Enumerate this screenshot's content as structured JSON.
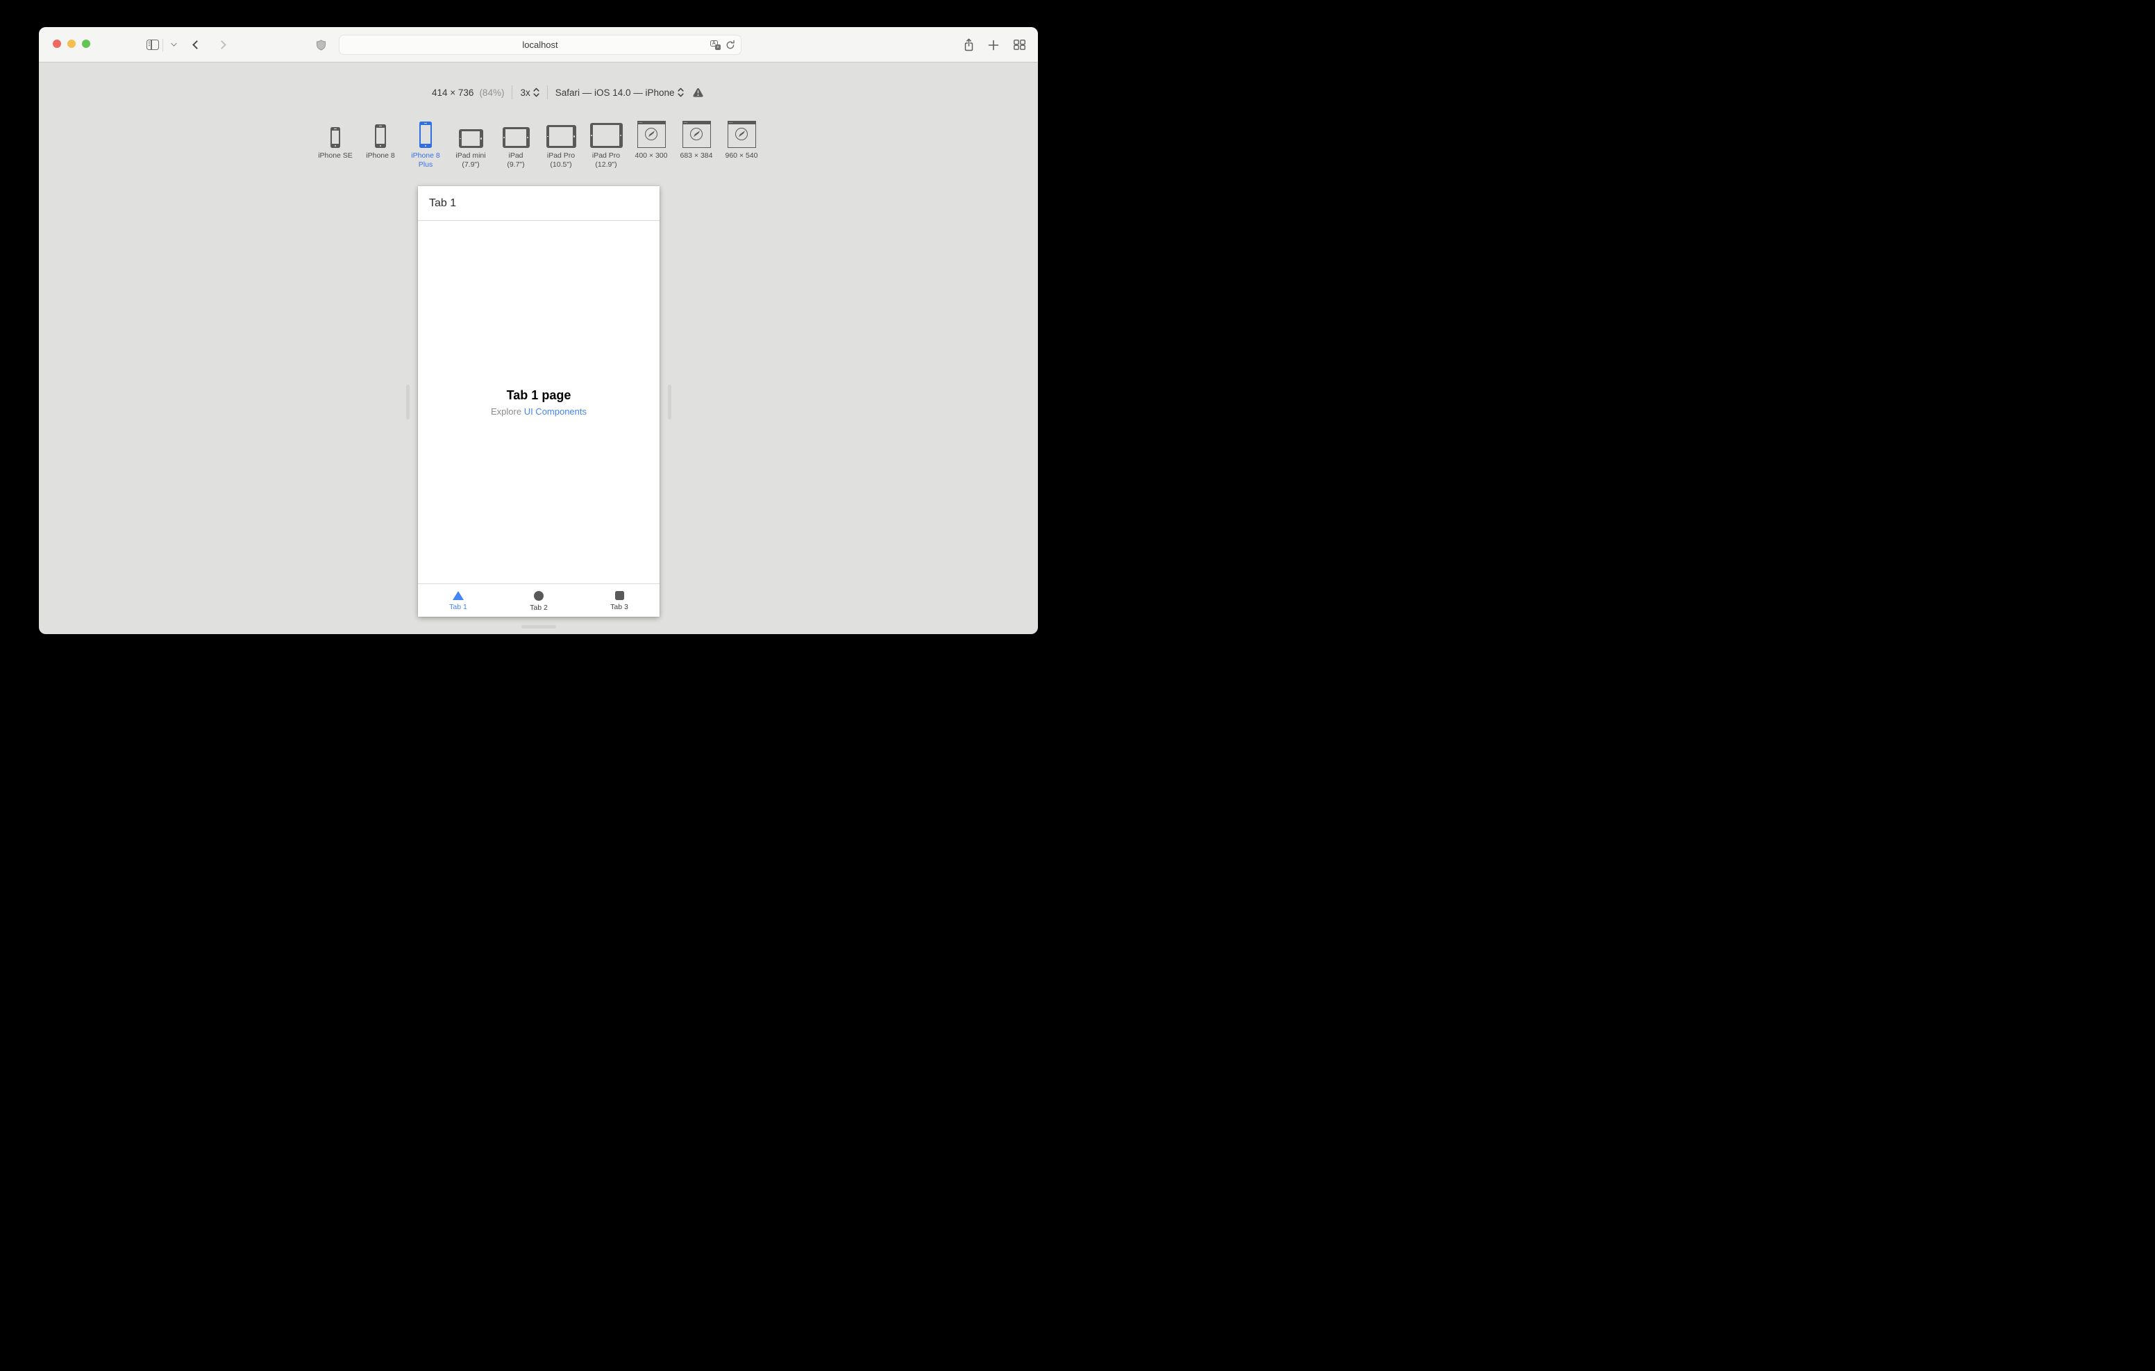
{
  "browser": {
    "address": "localhost"
  },
  "responsive_toolbar": {
    "dimensions": "414 × 736",
    "zoom": "(84%)",
    "scale": "3x",
    "user_agent": "Safari — iOS 14.0 — iPhone"
  },
  "devices": [
    {
      "label": "iPhone SE",
      "label2": "",
      "type": "iphone-icon",
      "selected": false
    },
    {
      "label": "iPhone 8",
      "label2": "",
      "type": "iphone-icon",
      "selected": false
    },
    {
      "label": "iPhone 8",
      "label2": "Plus",
      "type": "iphone-icon",
      "selected": true
    },
    {
      "label": "iPad mini",
      "label2": "(7.9\")",
      "type": "ipad-icon",
      "selected": false
    },
    {
      "label": "iPad",
      "label2": "(9.7\")",
      "type": "ipad-icon",
      "selected": false
    },
    {
      "label": "iPad Pro",
      "label2": "(10.5\")",
      "type": "ipad-icon",
      "selected": false
    },
    {
      "label": "iPad Pro",
      "label2": "(12.9\")",
      "type": "ipad-icon",
      "selected": false
    },
    {
      "label": "400 × 300",
      "label2": "",
      "type": "safari-window-icon",
      "selected": false
    },
    {
      "label": "683 × 384",
      "label2": "",
      "type": "safari-window-icon",
      "selected": false
    },
    {
      "label": "960 × 540",
      "label2": "",
      "type": "safari-window-icon",
      "selected": false
    }
  ],
  "preview": {
    "header_title": "Tab 1",
    "page_title": "Tab 1 page",
    "explore_prefix": "Explore",
    "explore_link": "UI Components",
    "tabs": [
      {
        "label": "Tab 1",
        "icon": "triangle-icon",
        "active": true
      },
      {
        "label": "Tab 2",
        "icon": "circle-icon",
        "active": false
      },
      {
        "label": "Tab 3",
        "icon": "square-icon",
        "active": false
      }
    ]
  },
  "icons": {
    "toolbar_left": [
      "sidebar-icon",
      "chevron-down-icon",
      "back-icon",
      "forward-icon"
    ],
    "address_bar": [
      "privacy-shield-icon",
      "translate-icon",
      "reload-icon"
    ],
    "toolbar_right": [
      "share-icon",
      "new-tab-icon",
      "tab-overview-icon"
    ],
    "responsive_toolbar": [
      "stepper-icon",
      "warning-icon"
    ]
  },
  "colors": {
    "accent_blue": "#2e6fe4",
    "link_blue": "#4285f4",
    "device_gray": "#595959",
    "window_bg": "#e0e0df",
    "titlebar_bg": "#f5f5f4"
  }
}
